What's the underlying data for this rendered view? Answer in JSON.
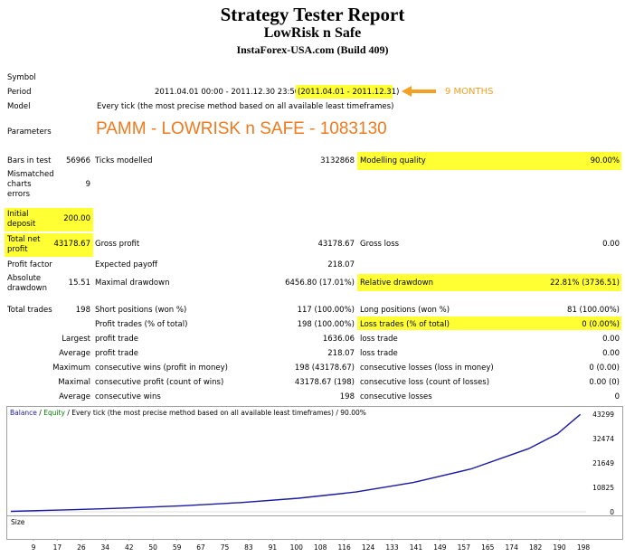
{
  "header": {
    "title": "Strategy Tester Report",
    "subtitle": "LowRisk n Safe",
    "broker": "InstaForex-USA.com (Build 409)"
  },
  "labels": {
    "symbol": "Symbol",
    "period": "Period",
    "model": "Model",
    "parameters": "Parameters",
    "bars": "Bars in test",
    "ticks": "Ticks modelled",
    "quality": "Modelling quality",
    "mismatched": [
      "Mismatched",
      "charts",
      "errors"
    ],
    "initial_deposit": [
      "Initial",
      "deposit"
    ],
    "total_net_profit": [
      "Total net",
      "profit"
    ],
    "gross_profit": "Gross profit",
    "gross_loss": "Gross loss",
    "profit_factor": "Profit factor",
    "expected_payoff": "Expected payoff",
    "absolute_drawdown": [
      "Absolute",
      "drawdown"
    ],
    "maximal_drawdown": "Maximal drawdown",
    "relative_drawdown": "Relative drawdown",
    "total_trades": "Total trades",
    "short_positions": "Short positions (won %)",
    "long_positions": "Long positions (won %)",
    "profit_trades": "Profit trades (% of total)",
    "loss_trades": "Loss trades (% of total)",
    "largest": "Largest",
    "average": "Average",
    "maximum": "Maximum",
    "maximal": "Maximal",
    "profit_trade": "profit trade",
    "loss_trade": "loss trade",
    "cons_wins_money": "consecutive wins (profit in money)",
    "cons_losses_money": "consecutive losses (loss in money)",
    "cons_profit_count": "consecutive profit (count of wins)",
    "cons_loss_count": "consecutive loss (count of losses)",
    "cons_wins": "consecutive wins",
    "cons_losses": "consecutive losses"
  },
  "values": {
    "period_range": "2011.04.01 00:00 - 2011.12.30 23:50",
    "period_hl": "(2011.04.01 - 2011.12.31)",
    "period_note": "9 MONTHS",
    "model": "Every tick (the most precise method based on all available least timeframes)",
    "parameters": "PAMM - LOWRISK n SAFE - 1083130",
    "bars": "56966",
    "ticks": "3132868",
    "quality": "90.00%",
    "mismatched": "9",
    "initial_deposit": "200.00",
    "total_net_profit": "43178.67",
    "gross_profit": "43178.67",
    "gross_loss": "0.00",
    "profit_factor": "",
    "expected_payoff": "218.07",
    "absolute_drawdown": "15.51",
    "maximal_drawdown": "6456.80 (17.01%)",
    "relative_drawdown": "22.81% (3736.51)",
    "total_trades": "198",
    "short_positions": "117 (100.00%)",
    "long_positions": "81 (100.00%)",
    "profit_trades": "198 (100.00%)",
    "loss_trades": "0 (0.00%)",
    "largest_profit": "1636.06",
    "largest_loss": "0.00",
    "average_profit": "218.07",
    "average_loss": "0.00",
    "max_cons_wins_money": "198 (43178.67)",
    "max_cons_losses_money": "0 (0.00)",
    "maxl_cons_profit": "43178.67 (198)",
    "maxl_cons_loss": "0.00 (0)",
    "avg_cons_wins": "198",
    "avg_cons_losses": "0"
  },
  "colors": {
    "highlight": "#ffff33",
    "params_orange": "#f07a1e",
    "note_orange": "#f5a020",
    "balance_line": "#1a1aa0",
    "equity_green": "#008000"
  },
  "chart_legend": {
    "balance": "Balance",
    "sep": " / ",
    "equity": "Equity",
    "desc": " / Every tick (the most precise method based on all available least timeframes) / 90.00%"
  },
  "size_panel_label": "Size",
  "chart_data": {
    "type": "line",
    "series": [
      {
        "name": "Balance",
        "x": [
          0,
          20,
          40,
          60,
          80,
          100,
          120,
          140,
          160,
          180,
          190,
          198
        ],
        "values": [
          200,
          900,
          1700,
          2700,
          4100,
          6000,
          8800,
          13000,
          19000,
          28000,
          34500,
          43179
        ]
      }
    ],
    "y_ticks": [
      "43299",
      "32474",
      "21649",
      "10825",
      "0"
    ],
    "x_ticks": [
      "9",
      "17",
      "26",
      "34",
      "42",
      "50",
      "59",
      "67",
      "75",
      "83",
      "91",
      "100",
      "108",
      "116",
      "124",
      "133",
      "141",
      "149",
      "157",
      "165",
      "174",
      "182",
      "190",
      "198"
    ],
    "ylim": [
      0,
      43299
    ],
    "xlim": [
      0,
      200
    ]
  }
}
